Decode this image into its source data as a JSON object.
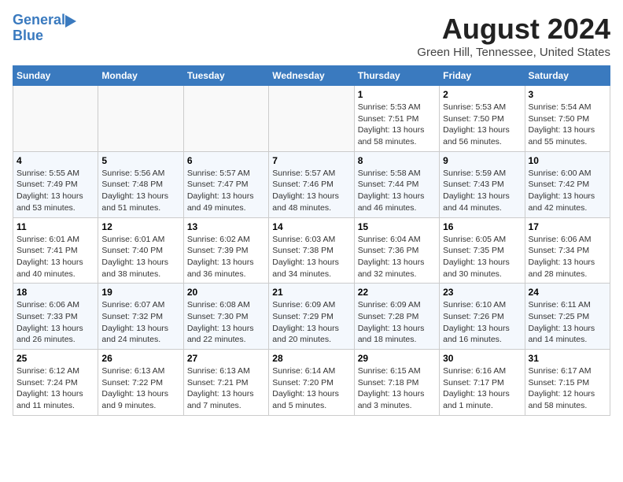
{
  "header": {
    "logo_line1": "General",
    "logo_line2": "Blue",
    "month_year": "August 2024",
    "location": "Green Hill, Tennessee, United States"
  },
  "weekdays": [
    "Sunday",
    "Monday",
    "Tuesday",
    "Wednesday",
    "Thursday",
    "Friday",
    "Saturday"
  ],
  "weeks": [
    [
      {
        "day": "",
        "info": ""
      },
      {
        "day": "",
        "info": ""
      },
      {
        "day": "",
        "info": ""
      },
      {
        "day": "",
        "info": ""
      },
      {
        "day": "1",
        "info": "Sunrise: 5:53 AM\nSunset: 7:51 PM\nDaylight: 13 hours\nand 58 minutes."
      },
      {
        "day": "2",
        "info": "Sunrise: 5:53 AM\nSunset: 7:50 PM\nDaylight: 13 hours\nand 56 minutes."
      },
      {
        "day": "3",
        "info": "Sunrise: 5:54 AM\nSunset: 7:50 PM\nDaylight: 13 hours\nand 55 minutes."
      }
    ],
    [
      {
        "day": "4",
        "info": "Sunrise: 5:55 AM\nSunset: 7:49 PM\nDaylight: 13 hours\nand 53 minutes."
      },
      {
        "day": "5",
        "info": "Sunrise: 5:56 AM\nSunset: 7:48 PM\nDaylight: 13 hours\nand 51 minutes."
      },
      {
        "day": "6",
        "info": "Sunrise: 5:57 AM\nSunset: 7:47 PM\nDaylight: 13 hours\nand 49 minutes."
      },
      {
        "day": "7",
        "info": "Sunrise: 5:57 AM\nSunset: 7:46 PM\nDaylight: 13 hours\nand 48 minutes."
      },
      {
        "day": "8",
        "info": "Sunrise: 5:58 AM\nSunset: 7:44 PM\nDaylight: 13 hours\nand 46 minutes."
      },
      {
        "day": "9",
        "info": "Sunrise: 5:59 AM\nSunset: 7:43 PM\nDaylight: 13 hours\nand 44 minutes."
      },
      {
        "day": "10",
        "info": "Sunrise: 6:00 AM\nSunset: 7:42 PM\nDaylight: 13 hours\nand 42 minutes."
      }
    ],
    [
      {
        "day": "11",
        "info": "Sunrise: 6:01 AM\nSunset: 7:41 PM\nDaylight: 13 hours\nand 40 minutes."
      },
      {
        "day": "12",
        "info": "Sunrise: 6:01 AM\nSunset: 7:40 PM\nDaylight: 13 hours\nand 38 minutes."
      },
      {
        "day": "13",
        "info": "Sunrise: 6:02 AM\nSunset: 7:39 PM\nDaylight: 13 hours\nand 36 minutes."
      },
      {
        "day": "14",
        "info": "Sunrise: 6:03 AM\nSunset: 7:38 PM\nDaylight: 13 hours\nand 34 minutes."
      },
      {
        "day": "15",
        "info": "Sunrise: 6:04 AM\nSunset: 7:36 PM\nDaylight: 13 hours\nand 32 minutes."
      },
      {
        "day": "16",
        "info": "Sunrise: 6:05 AM\nSunset: 7:35 PM\nDaylight: 13 hours\nand 30 minutes."
      },
      {
        "day": "17",
        "info": "Sunrise: 6:06 AM\nSunset: 7:34 PM\nDaylight: 13 hours\nand 28 minutes."
      }
    ],
    [
      {
        "day": "18",
        "info": "Sunrise: 6:06 AM\nSunset: 7:33 PM\nDaylight: 13 hours\nand 26 minutes."
      },
      {
        "day": "19",
        "info": "Sunrise: 6:07 AM\nSunset: 7:32 PM\nDaylight: 13 hours\nand 24 minutes."
      },
      {
        "day": "20",
        "info": "Sunrise: 6:08 AM\nSunset: 7:30 PM\nDaylight: 13 hours\nand 22 minutes."
      },
      {
        "day": "21",
        "info": "Sunrise: 6:09 AM\nSunset: 7:29 PM\nDaylight: 13 hours\nand 20 minutes."
      },
      {
        "day": "22",
        "info": "Sunrise: 6:09 AM\nSunset: 7:28 PM\nDaylight: 13 hours\nand 18 minutes."
      },
      {
        "day": "23",
        "info": "Sunrise: 6:10 AM\nSunset: 7:26 PM\nDaylight: 13 hours\nand 16 minutes."
      },
      {
        "day": "24",
        "info": "Sunrise: 6:11 AM\nSunset: 7:25 PM\nDaylight: 13 hours\nand 14 minutes."
      }
    ],
    [
      {
        "day": "25",
        "info": "Sunrise: 6:12 AM\nSunset: 7:24 PM\nDaylight: 13 hours\nand 11 minutes."
      },
      {
        "day": "26",
        "info": "Sunrise: 6:13 AM\nSunset: 7:22 PM\nDaylight: 13 hours\nand 9 minutes."
      },
      {
        "day": "27",
        "info": "Sunrise: 6:13 AM\nSunset: 7:21 PM\nDaylight: 13 hours\nand 7 minutes."
      },
      {
        "day": "28",
        "info": "Sunrise: 6:14 AM\nSunset: 7:20 PM\nDaylight: 13 hours\nand 5 minutes."
      },
      {
        "day": "29",
        "info": "Sunrise: 6:15 AM\nSunset: 7:18 PM\nDaylight: 13 hours\nand 3 minutes."
      },
      {
        "day": "30",
        "info": "Sunrise: 6:16 AM\nSunset: 7:17 PM\nDaylight: 13 hours\nand 1 minute."
      },
      {
        "day": "31",
        "info": "Sunrise: 6:17 AM\nSunset: 7:15 PM\nDaylight: 12 hours\nand 58 minutes."
      }
    ]
  ]
}
